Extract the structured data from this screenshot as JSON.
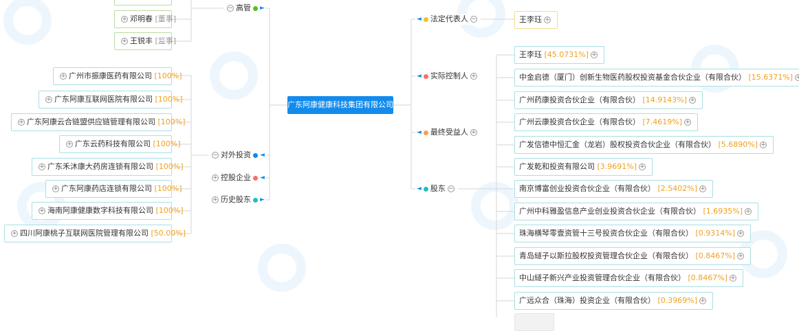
{
  "center": {
    "label": "广东阿康健康科技集团有限公司"
  },
  "colors": {
    "center": "#128bed",
    "green": "#52c41a",
    "red": "#ff6b6b",
    "orange": "#ff9c4a",
    "yellow": "#f0c030",
    "teal": "#1fbfbf",
    "blue": "#128bed",
    "pct": "#f0a020"
  },
  "left": {
    "categories": [
      {
        "label": "高管",
        "dot": "green"
      },
      {
        "label": "对外投资",
        "dot": "blue"
      },
      {
        "label": "控股企业",
        "dot": "red"
      },
      {
        "label": "历史股东",
        "dot": "teal"
      }
    ],
    "executives": [
      {
        "name": "邓明春",
        "role": "[董事]"
      },
      {
        "name": "王锐丰",
        "role": "[监事]"
      }
    ],
    "investments": [
      {
        "name": "广州市振康医药有限公司",
        "pct": "[100%]"
      },
      {
        "name": "广东阿康互联网医院有限公司",
        "pct": "[100%]"
      },
      {
        "name": "广东阿康云合链盟供应链管理有限公司",
        "pct": "[100%]"
      },
      {
        "name": "广东云药科技有限公司",
        "pct": "[100%]"
      },
      {
        "name": "广东禾沐康大药房连锁有限公司",
        "pct": "[100%]"
      },
      {
        "name": "广东阿康药店连锁有限公司",
        "pct": "[100%]"
      },
      {
        "name": "海南阿康健康数字科技有限公司",
        "pct": "[100%]"
      },
      {
        "name": "四川阿康桃子互联网医院管理有限公司",
        "pct": "[50.00%]"
      }
    ]
  },
  "right": {
    "categories": [
      {
        "label": "法定代表人",
        "dot": "yellow"
      },
      {
        "label": "实际控制人",
        "dot": "red"
      },
      {
        "label": "最终受益人",
        "dot": "orange"
      },
      {
        "label": "股东",
        "dot": "teal"
      }
    ],
    "legal_rep": {
      "name": "王李珏"
    },
    "shareholders": [
      {
        "name": "王李珏",
        "pct": "[45.0731%]"
      },
      {
        "name": "中金启德（厦门）创新生物医药股权投资基金合伙企业（有限合伙）",
        "pct": "[15.6371%]"
      },
      {
        "name": "广州药康投资合伙企业（有限合伙）",
        "pct": "[14.9143%]"
      },
      {
        "name": "广州云康投资合伙企业（有限合伙）",
        "pct": "[7.4619%]"
      },
      {
        "name": "广发信德中恒汇金（龙岩）股权投资合伙企业（有限合伙）",
        "pct": "[5.6890%]"
      },
      {
        "name": "广发乾和投资有限公司",
        "pct": "[3.9691%]"
      },
      {
        "name": "南京博富创业投资合伙企业（有限合伙）",
        "pct": "[2.5402%]"
      },
      {
        "name": "广州中科雅盈信息产业创业投资合伙企业（有限合伙）",
        "pct": "[1.6935%]"
      },
      {
        "name": "珠海横琴零壹资管十三号投资合伙企业（有限合伙）",
        "pct": "[0.9314%]"
      },
      {
        "name": "青岛繸子以斯拉股权投资管理合伙企业（有限合伙）",
        "pct": "[0.8467%]"
      },
      {
        "name": "中山繸子新兴产业投资管理合伙企业（有限合伙）",
        "pct": "[0.8467%]"
      },
      {
        "name": "广远众合（珠海）投资企业（有限合伙）",
        "pct": "[0.3969%]"
      }
    ]
  }
}
